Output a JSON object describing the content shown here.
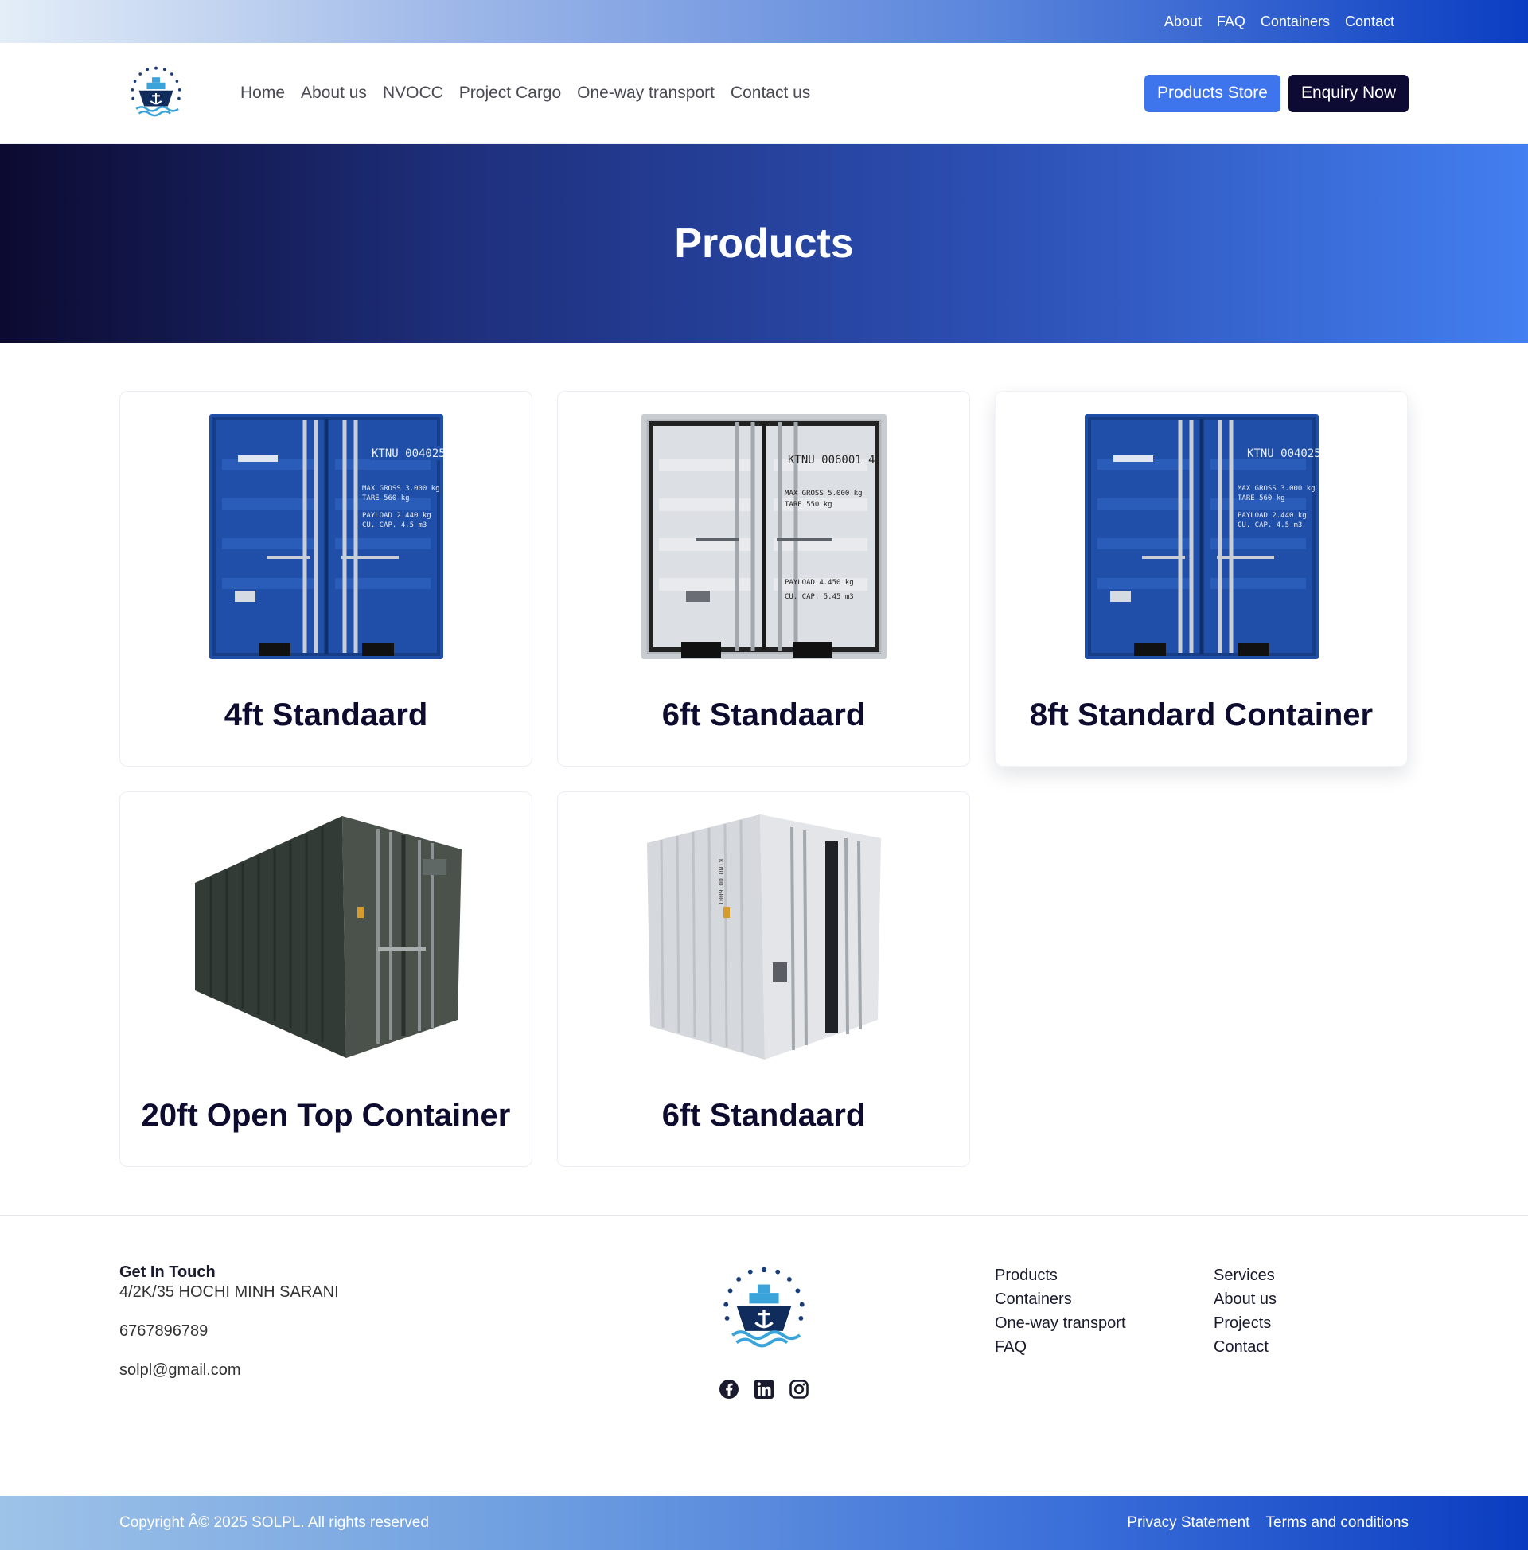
{
  "topbar": {
    "links": [
      "About",
      "FAQ",
      "Containers",
      "Contact"
    ]
  },
  "header": {
    "logo_icon": "ship-anchor-logo-icon",
    "nav": [
      "Home",
      "About us",
      "NVOCC",
      "Project Cargo",
      "One-way transport",
      "Contact us"
    ],
    "store_button": "Products Store",
    "enquiry_button": "Enquiry Now"
  },
  "hero": {
    "title": "Products"
  },
  "products": [
    {
      "name": "4ft Standaard",
      "image": "blue-container-doors"
    },
    {
      "name": "6ft Standaard",
      "image": "white-container-doors"
    },
    {
      "name": "8ft Standard Container",
      "image": "blue-container-doors"
    },
    {
      "name": "20ft Open Top Container",
      "image": "dark-green-container-perspective"
    },
    {
      "name": "6ft Standaard",
      "image": "white-container-perspective"
    }
  ],
  "footer": {
    "get_in_touch": "Get In Touch",
    "address": "4/2K/35 HOCHI MINH SARANI",
    "phone": "6767896789",
    "email": "solpl@gmail.com",
    "socials": [
      "facebook-icon",
      "linkedin-icon",
      "instagram-icon"
    ],
    "col1": [
      "Products",
      "Containers",
      "One-way transport",
      "FAQ"
    ],
    "col2": [
      "Services",
      "About us",
      "Projects",
      "Contact"
    ]
  },
  "bottombar": {
    "copyright": "Copyright Â© 2025 SOLPL. All rights reserved",
    "privacy": "Privacy Statement",
    "terms": "Terms and conditions"
  },
  "colors": {
    "accent_blue": "#3e74ec",
    "dark_navy": "#0d0b33",
    "container_blue": "#1f4fa8"
  }
}
